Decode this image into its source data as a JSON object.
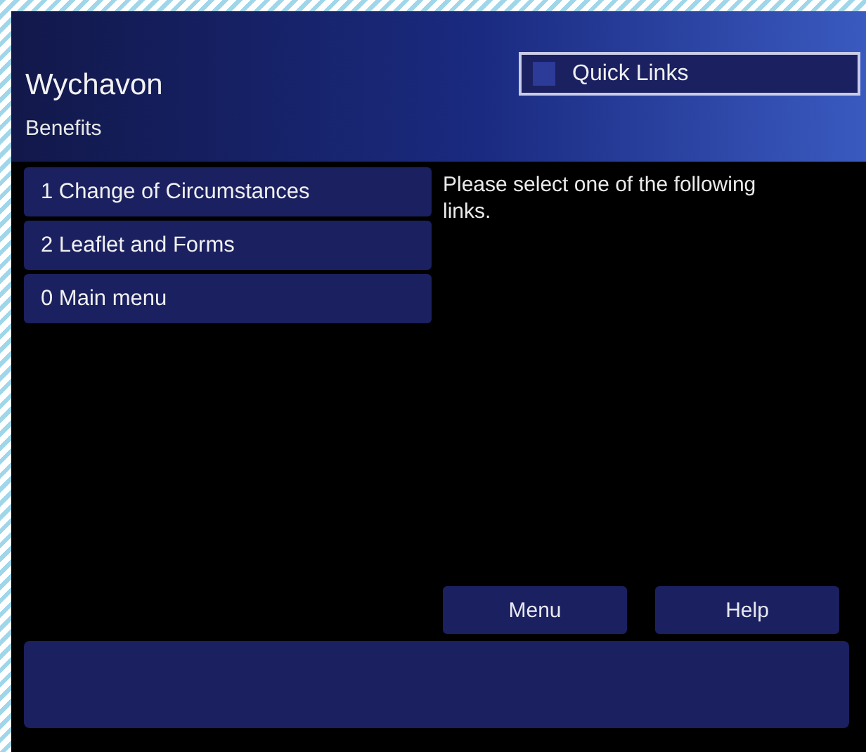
{
  "header": {
    "title": "Wychavon",
    "section": "Benefits",
    "quick_links": "Quick Links"
  },
  "menu_items": [
    {
      "label": "1 Change of Circumstances"
    },
    {
      "label": "2 Leaflet and Forms"
    },
    {
      "label": "0 Main menu"
    }
  ],
  "message": "Please select one of the following links.",
  "buttons": [
    "Menu",
    "Help"
  ]
}
